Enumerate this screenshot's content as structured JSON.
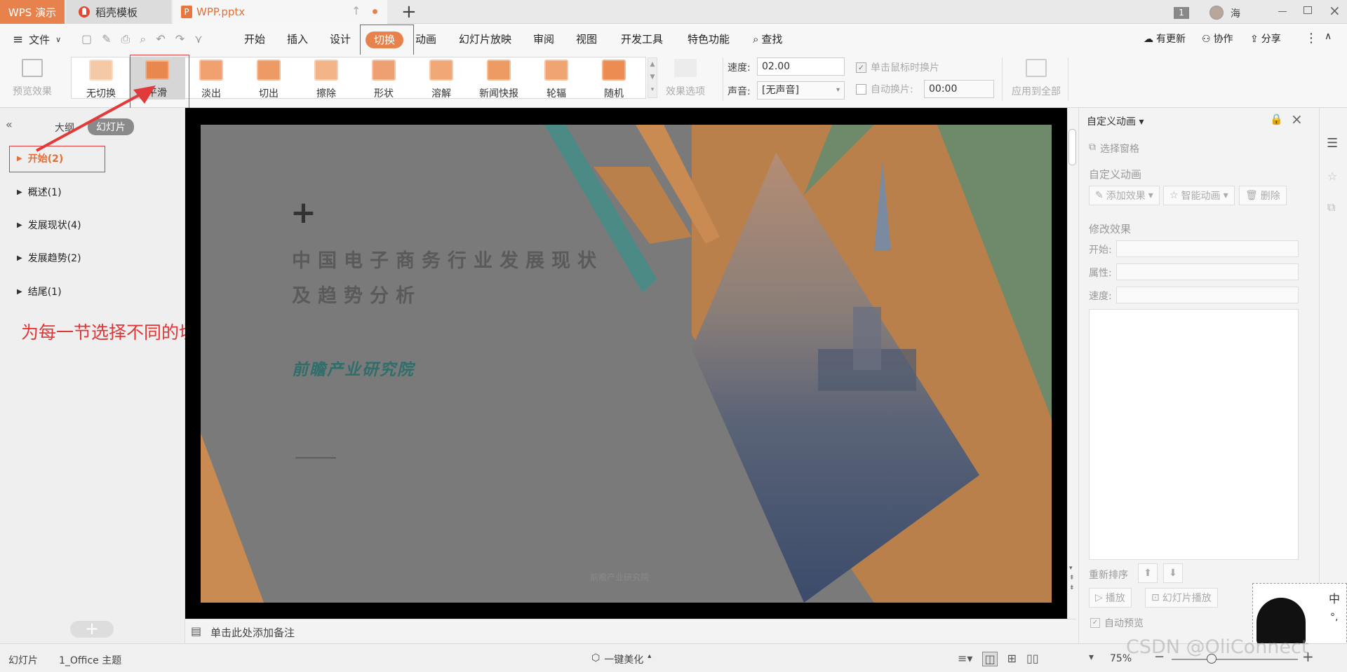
{
  "titlebar": {
    "app_label": "WPS 演示",
    "tabs": [
      {
        "label": "稻壳模板"
      },
      {
        "label": "WPP.pptx"
      }
    ],
    "page_badge": "1",
    "user_name": "海"
  },
  "menubar": {
    "file_label": "文件",
    "items": [
      "开始",
      "插入",
      "设计",
      "切换",
      "动画",
      "幻灯片放映",
      "审阅",
      "视图",
      "开发工具",
      "特色功能"
    ],
    "active_item": "切换",
    "search_label": "查找",
    "right_items": [
      "有更新",
      "协作",
      "分享"
    ]
  },
  "ribbon": {
    "preview_label": "预览效果",
    "transitions": [
      {
        "label": "无切换",
        "color": "#f6c9a6"
      },
      {
        "label": "平滑",
        "color": "#e9884e"
      },
      {
        "label": "淡出",
        "color": "#f1a06f"
      },
      {
        "label": "切出",
        "color": "#ee9a65"
      },
      {
        "label": "擦除",
        "color": "#f3b488"
      },
      {
        "label": "形状",
        "color": "#eea073"
      },
      {
        "label": "溶解",
        "color": "#f0a877"
      },
      {
        "label": "新闻快报",
        "color": "#ee9b63"
      },
      {
        "label": "轮辐",
        "color": "#f0a471"
      },
      {
        "label": "随机",
        "color": "#ec8c52"
      }
    ],
    "selected_transition": "平滑",
    "effect_options_label": "效果选项",
    "speed_label": "速度:",
    "speed_value": "02.00",
    "sound_label": "声音:",
    "sound_value": "[无声音]",
    "on_click_label": "单击鼠标时换片",
    "on_click_checked": true,
    "auto_label": "自动换片:",
    "auto_checked": false,
    "auto_value": "00:00",
    "apply_all_label": "应用到全部"
  },
  "left_panel": {
    "tab_outline": "大纲",
    "tab_slides": "幻灯片",
    "sections": [
      {
        "label": "开始(2)",
        "active": true
      },
      {
        "label": "概述(1)",
        "active": false
      },
      {
        "label": "发展现状(4)",
        "active": false
      },
      {
        "label": "发展趋势(2)",
        "active": false
      },
      {
        "label": "结尾(1)",
        "active": false
      }
    ],
    "annotation": "为每一节选择不同的切换方式"
  },
  "slide": {
    "plus_mark": "+",
    "title_line1": "中国电子商务行业发展现状",
    "title_line2": "及趋势分析",
    "subtitle": "前瞻产业研究院",
    "footer": "前瞻产业研究院"
  },
  "notes": {
    "placeholder": "单击此处添加备注"
  },
  "right_panel": {
    "title": "自定义动画",
    "select_pane": "选择窗格",
    "section1": "自定义动画",
    "add_effect": "添加效果",
    "smart_anim": "智能动画",
    "delete": "删除",
    "section2": "修改效果",
    "start_label": "开始:",
    "property_label": "属性:",
    "speed_label": "速度:",
    "reorder_label": "重新排序",
    "play_label": "播放",
    "slideshow_label": "幻灯片播放",
    "autopreview_label": "自动预览"
  },
  "statusbar": {
    "view_label": "幻灯片",
    "theme_label": "1_Office 主题",
    "beautify_label": "一键美化",
    "zoom": "75%",
    "watermark": "CSDN @OliConnect"
  },
  "ime": {
    "lang": "中",
    "punct": "°,"
  }
}
